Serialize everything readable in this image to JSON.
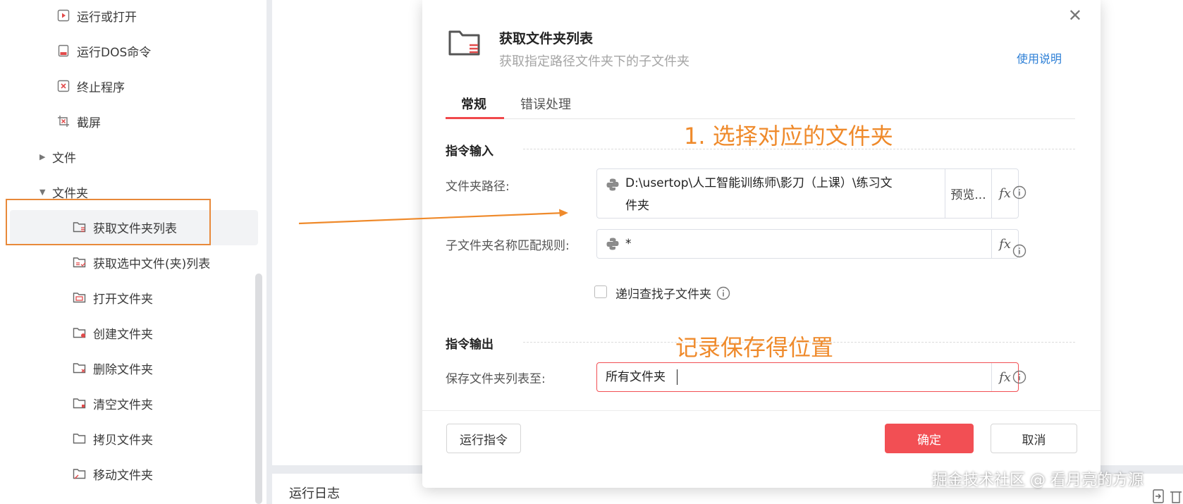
{
  "sidebar": {
    "items_top": [
      {
        "label": "运行或打开",
        "icon": "run-open-icon"
      },
      {
        "label": "运行DOS命令",
        "icon": "dos-command-icon"
      },
      {
        "label": "终止程序",
        "icon": "terminate-program-icon"
      },
      {
        "label": "截屏",
        "icon": "screenshot-icon"
      }
    ],
    "group_file": "文件",
    "group_folder": "文件夹",
    "folder_items": [
      {
        "label": "获取文件夹列表",
        "icon": "folder-list-icon"
      },
      {
        "label": "获取选中文件(夹)列表",
        "icon": "folder-selected-list-icon"
      },
      {
        "label": "打开文件夹",
        "icon": "folder-open-icon"
      },
      {
        "label": "创建文件夹",
        "icon": "folder-create-icon"
      },
      {
        "label": "删除文件夹",
        "icon": "folder-delete-icon"
      },
      {
        "label": "清空文件夹",
        "icon": "folder-clear-icon"
      },
      {
        "label": "拷贝文件夹",
        "icon": "folder-copy-icon"
      },
      {
        "label": "移动文件夹",
        "icon": "folder-move-icon"
      }
    ]
  },
  "log_panel": {
    "title": "运行日志"
  },
  "dialog": {
    "title": "获取文件夹列表",
    "subtitle": "获取指定路径文件夹下的子文件夹",
    "help_link": "使用说明",
    "tabs": [
      "常规",
      "错误处理"
    ],
    "section_input": "指令输入",
    "section_output": "指令输出",
    "fields": {
      "folder_path": {
        "label": "文件夹路径:",
        "value_line1": "D:\\usertop\\人工智能训练师\\影刀（上课）\\练习文",
        "value_line2": "件夹",
        "preview_label": "预览..."
      },
      "name_rule": {
        "label": "子文件夹名称匹配规则:",
        "value": "*"
      },
      "recursive": {
        "label": "递归查找子文件夹",
        "checked": false
      },
      "save_to": {
        "label": "保存文件夹列表至:",
        "value": "所有文件夹"
      }
    },
    "fx_label": "fx",
    "buttons": {
      "run": "运行指令",
      "ok": "确定",
      "cancel": "取消"
    },
    "colors": {
      "accent": "#f24f54",
      "link": "#2d7fd6"
    }
  },
  "annotations": {
    "step1": "1. 选择对应的文件夹",
    "step2": "记录保存得位置",
    "color": "#ef8a2b"
  },
  "watermark": "掘金技术社区 @ 看月亮的方源"
}
